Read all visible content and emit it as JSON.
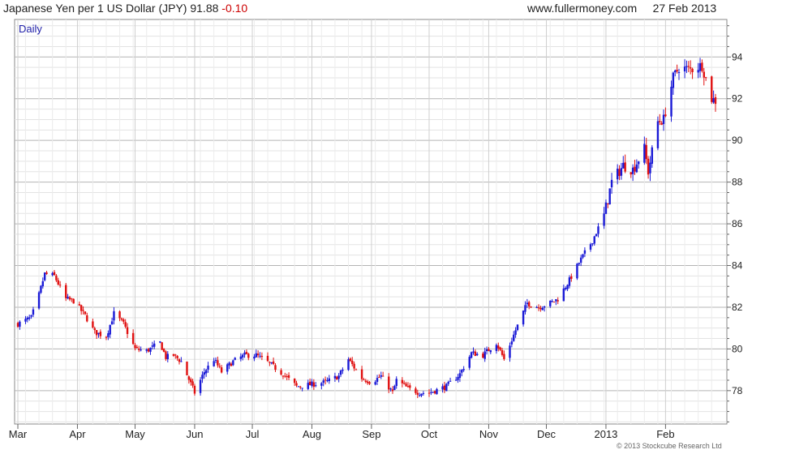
{
  "header": {
    "instrument": "Japanese Yen per 1 US Dollar (JPY)",
    "last_price": "91.88",
    "change": "-0.10",
    "website": "www.fullermoney.com",
    "date": "27 Feb 2013"
  },
  "footer": {
    "copyright": "© 2013 Stockcube Research Ltd"
  },
  "colors": {
    "up": "#1a1ad6",
    "down": "#e01010",
    "grid": "#c8c8c8"
  },
  "chart_data": {
    "type": "candlestick",
    "label": "Daily",
    "ylim": [
      76.4,
      95.8
    ],
    "y_ticks": [
      78,
      80,
      82,
      84,
      86,
      88,
      90,
      92,
      94
    ],
    "x_labels": [
      "Mar",
      "Apr",
      "May",
      "Jun",
      "Jul",
      "Aug",
      "Sep",
      "Oct",
      "Nov",
      "Dec",
      "2013",
      "Feb"
    ],
    "grid": true,
    "start_date": "2012-03-01",
    "end_date": "2013-02-27",
    "close_path": [
      [
        "2012-03-01",
        81.2
      ],
      [
        "2012-03-08",
        81.5
      ],
      [
        "2012-03-12",
        82.6
      ],
      [
        "2012-03-15",
        83.6
      ],
      [
        "2012-03-20",
        83.5
      ],
      [
        "2012-03-26",
        82.4
      ],
      [
        "2012-03-30",
        82.3
      ],
      [
        "2012-04-05",
        81.6
      ],
      [
        "2012-04-10",
        80.8
      ],
      [
        "2012-04-16",
        80.6
      ],
      [
        "2012-04-20",
        81.7
      ],
      [
        "2012-04-25",
        81.2
      ],
      [
        "2012-05-01",
        80.0
      ],
      [
        "2012-05-07",
        79.9
      ],
      [
        "2012-05-14",
        80.3
      ],
      [
        "2012-05-17",
        79.6
      ],
      [
        "2012-05-21",
        79.7
      ],
      [
        "2012-05-25",
        79.4
      ],
      [
        "2012-06-01",
        77.9
      ],
      [
        "2012-06-06",
        78.9
      ],
      [
        "2012-06-11",
        79.5
      ],
      [
        "2012-06-15",
        78.9
      ],
      [
        "2012-06-21",
        79.4
      ],
      [
        "2012-06-27",
        79.7
      ],
      [
        "2012-07-03",
        79.7
      ],
      [
        "2012-07-10",
        79.3
      ],
      [
        "2012-07-17",
        78.8
      ],
      [
        "2012-07-24",
        78.2
      ],
      [
        "2012-08-01",
        78.3
      ],
      [
        "2012-08-08",
        78.4
      ],
      [
        "2012-08-15",
        78.7
      ],
      [
        "2012-08-20",
        79.5
      ],
      [
        "2012-08-27",
        78.6
      ],
      [
        "2012-09-01",
        78.4
      ],
      [
        "2012-09-06",
        78.7
      ],
      [
        "2012-09-12",
        77.9
      ],
      [
        "2012-09-14",
        78.5
      ],
      [
        "2012-09-20",
        78.1
      ],
      [
        "2012-09-26",
        77.9
      ],
      [
        "2012-10-01",
        77.9
      ],
      [
        "2012-10-10",
        78.2
      ],
      [
        "2012-10-17",
        78.8
      ],
      [
        "2012-10-23",
        79.8
      ],
      [
        "2012-10-29",
        79.7
      ],
      [
        "2012-11-05",
        80.3
      ],
      [
        "2012-11-09",
        79.5
      ],
      [
        "2012-11-15",
        80.9
      ],
      [
        "2012-11-21",
        82.2
      ],
      [
        "2012-11-27",
        82.0
      ],
      [
        "2012-12-03",
        82.2
      ],
      [
        "2012-12-07",
        82.4
      ],
      [
        "2012-12-13",
        83.3
      ],
      [
        "2012-12-19",
        84.3
      ],
      [
        "2012-12-25",
        85.2
      ],
      [
        "2012-12-31",
        86.4
      ],
      [
        "2013-01-04",
        88.0
      ],
      [
        "2013-01-10",
        88.8
      ],
      [
        "2013-01-15",
        88.6
      ],
      [
        "2013-01-21",
        89.6
      ],
      [
        "2013-01-23",
        88.5
      ],
      [
        "2013-01-28",
        90.9
      ],
      [
        "2013-01-31",
        91.0
      ],
      [
        "2013-02-05",
        93.0
      ],
      [
        "2013-02-08",
        93.5
      ],
      [
        "2013-02-14",
        93.4
      ],
      [
        "2013-02-20",
        93.6
      ],
      [
        "2013-02-25",
        92.0
      ],
      [
        "2013-02-27",
        91.9
      ]
    ]
  }
}
